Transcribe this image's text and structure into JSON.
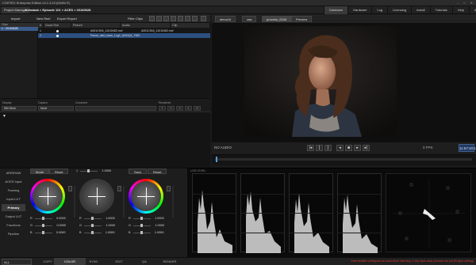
{
  "window": {
    "title": "CORTEX Enterprise Edition v3.1.3.43 (b5d3c7f)"
  },
  "header": {
    "project_label": "Project Manager",
    "breadcrumb": "Kebabab » Episode 101 » ACES » 20160628",
    "menu": [
      "Database",
      "Hardware",
      "Log",
      "Licensing",
      "Install MP",
      "Tutorials",
      "Help",
      "About"
    ]
  },
  "toolbar": {
    "import_label": "Import",
    "new_reel_label": "New Reel",
    "export_report_label": "Export Report",
    "filter_clips_label": "Filter Clips"
  },
  "clips": {
    "header": "Clips",
    "selected": "1 · 20160628"
  },
  "file_table": {
    "columns": [
      "#",
      "Good Roll",
      "Picture",
      "Audio",
      "Clip"
    ],
    "rows": [
      {
        "num": "1",
        "picture": "A001C004_11010452.mxf",
        "audio": "A001C004_11010452.mxf"
      },
      {
        "num": "2",
        "picture": "Pause_aleo_base_Log2_A004Q4_7580",
        "audio": ""
      }
    ]
  },
  "metadata": {
    "labels": [
      "Display",
      "Caption",
      "Comment",
      "Rendered"
    ],
    "display_value": "Still Store",
    "caption_value": "None",
    "numbers": [
      "1",
      "2",
      "3",
      "4",
      "5"
    ]
  },
  "viewer": {
    "tabs": [
      "alexa16",
      "raw",
      "process_0046",
      "Preview"
    ]
  },
  "transport": {
    "audio": "NO AUDIO",
    "fps": "0 FPS",
    "timecode": "11:57:40:15"
  },
  "colorpanel": {
    "sidebar": [
      "ARRIRAW",
      "ACES Input",
      "Framing",
      "Input LUT",
      "Primary",
      "Output LUT",
      "Functions",
      "Pipeline"
    ],
    "active": "Primary",
    "mode_label": "Mode",
    "reset_label": "Reset",
    "gamma_value": "1.0000",
    "save_label": "Save",
    "reset2_label": "Reset",
    "lift_values": [
      "0.0000",
      "0.0000",
      "0.0000"
    ],
    "gamma_values": [
      "1.0000",
      "1.0000",
      "1.0000"
    ],
    "gain_values": [
      "1.0000",
      "1.0000",
      "1.0000"
    ]
  },
  "scopes": {
    "label": "LOG LEVEL"
  },
  "bottombar": {
    "all_label": "ALL",
    "tabs": [
      "COPY",
      "COLOR",
      "SYNC",
      "EDIT",
      "QA",
      "RENDER"
    ],
    "active": "COLOR",
    "warning": "Intermediate configured as local drive! Warning: 1 clip have clear process not yet (Project setting)"
  },
  "colors": {
    "accent": "#3a5a8a",
    "timecode": "#223a5e",
    "warning": "#e03a2b"
  }
}
